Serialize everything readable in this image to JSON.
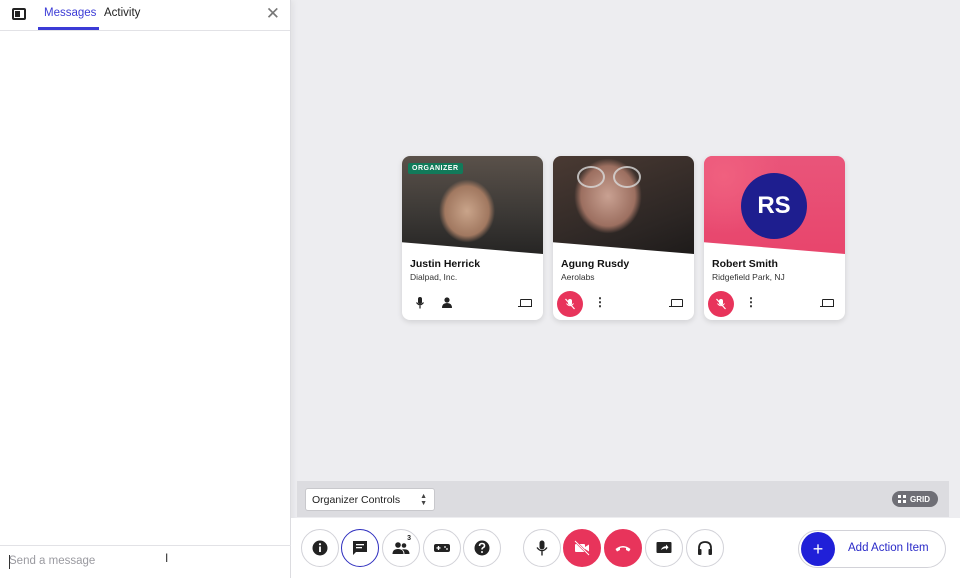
{
  "sidebar": {
    "tabs": [
      {
        "label": "Messages",
        "active": true
      },
      {
        "label": "Activity",
        "active": false
      }
    ],
    "message_input": {
      "placeholder": "Send a message",
      "value": ""
    }
  },
  "participants": [
    {
      "name": "Justin Herrick",
      "subtitle": "Dialpad, Inc.",
      "badge": "ORGANIZER",
      "muted": false
    },
    {
      "name": "Agung Rusdy",
      "subtitle": "Aerolabs",
      "muted": true
    },
    {
      "name": "Robert Smith",
      "subtitle": "Ridgefield Park, NJ",
      "initials": "RS",
      "muted": true
    }
  ],
  "organizer_bar": {
    "select_value": "Organizer Controls",
    "grid_label": "GRID"
  },
  "toolbar": {
    "participants_count": "3",
    "add_action_label": "Add Action Item"
  },
  "colors": {
    "accent": "#3b3bd6",
    "danger": "#e8345b",
    "organizer_badge": "#127a5a",
    "avatar_bg": "#1e1e8f",
    "card_pink": "#e8456c"
  }
}
